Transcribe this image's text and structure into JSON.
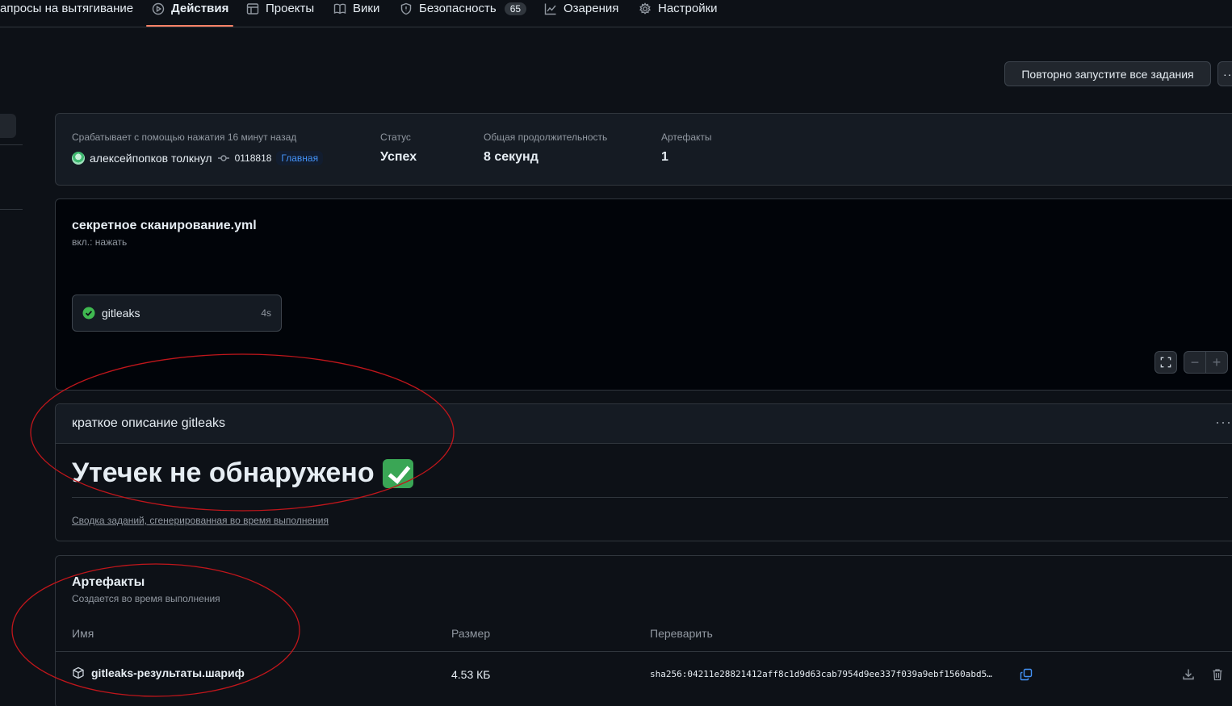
{
  "nav": {
    "items": [
      {
        "label": "апросы на вытягивание",
        "icon": "pull-request-icon"
      },
      {
        "label": "Действия",
        "icon": "play-circle-icon"
      },
      {
        "label": "Проекты",
        "icon": "table-icon"
      },
      {
        "label": "Вики",
        "icon": "book-icon"
      },
      {
        "label": "Безопасность",
        "icon": "shield-icon",
        "count": "65"
      },
      {
        "label": "Озарения",
        "icon": "graph-icon"
      },
      {
        "label": "Настройки",
        "icon": "gear-icon"
      }
    ]
  },
  "actions": {
    "rerun_label": "Повторно запустите все задания",
    "more_label": "···"
  },
  "summary": {
    "trigger_label": "Срабатывает с помощью нажатия 16 минут назад",
    "actor": "алексейпопков толкнул",
    "commit": "0118818",
    "branch": "Главная",
    "status_label": "Статус",
    "status_value": "Успех",
    "duration_label": "Общая продолжительность",
    "duration_value": "8 секунд",
    "artifacts_label": "Артефакты",
    "artifacts_value": "1"
  },
  "workflow": {
    "title": "секретное сканирование.yml",
    "subtitle": "вкл.: нажать",
    "job": {
      "name": "gitleaks",
      "duration": "4s",
      "status": "success"
    },
    "zoom": {
      "minus": "−",
      "plus": "+"
    }
  },
  "gitleaks_summary": {
    "header": "краткое описание gitleaks",
    "headline": "Утечек не обнаружено",
    "footer_link": "Сводка заданий, сгенерированная во время выполнения",
    "more_label": "···"
  },
  "artifacts": {
    "title": "Артефакты",
    "subtitle": "Создается во время выполнения",
    "columns": [
      "Имя",
      "Размер",
      "Переварить"
    ],
    "rows": [
      {
        "name": "gitleaks-результаты.шариф",
        "size": "4.53 КБ",
        "digest": "sha256:04211e28821412aff8c1d9d63cab7954d9ee337f039a9ebf1560abd5…"
      }
    ]
  },
  "colors": {
    "accent_underline": "#f78166",
    "success": "#3fb950",
    "annotation": "#c0161b",
    "link_blue": "#4493f8"
  }
}
